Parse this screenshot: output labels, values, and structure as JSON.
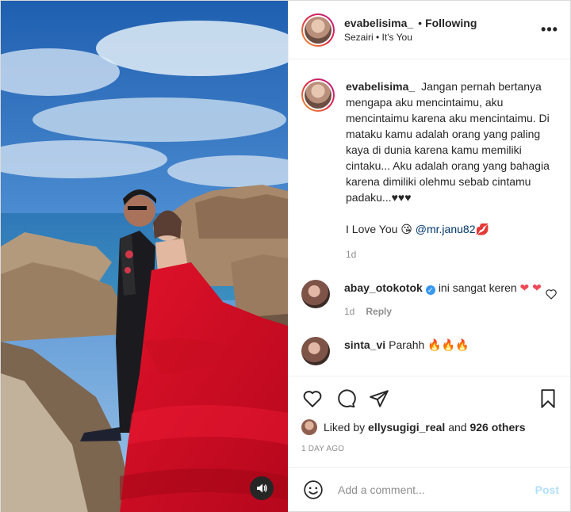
{
  "post": {
    "username": "evabelisima_",
    "follow_status": "Following",
    "separator": "•",
    "music": "Sezairi • It's You",
    "more": "•••"
  },
  "caption": {
    "username": "evabelisima_",
    "text": "Jangan pernah bertanya mengapa aku mencintaimu, aku mencintaimu karena aku mencintaimu. Di mataku kamu adalah orang yang paling kaya di dunia karena kamu memiliki cintaku... Aku adalah orang yang bahagia karena dimiliki olehmu sebab cintamu padaku...♥♥♥",
    "line2_prefix": "I Love You 😘 ",
    "mention": "@mr.janu82",
    "line2_suffix": "💋",
    "age": "1d"
  },
  "comments": [
    {
      "username": "abay_otokotok",
      "verified": "✓",
      "text": "ini sangat keren",
      "hearts": "❤ ❤",
      "age": "1d",
      "reply": "Reply"
    },
    {
      "username": "sinta_vi",
      "text": "Parahh 🔥🔥🔥"
    }
  ],
  "likes": {
    "prefix": "Liked by ",
    "user": "ellysugigi_real",
    "middle": " and ",
    "others": "926 others"
  },
  "timestamp": "1 DAY AGO",
  "composer": {
    "placeholder": "Add a comment...",
    "post_label": "Post"
  },
  "colors": {
    "link": "#00376b",
    "verified": "#3897f0",
    "post_disabled": "#b2dffc",
    "muted": "#8e8e8e",
    "heart": "#ed4956"
  },
  "icons": [
    "audio-icon",
    "more-icon",
    "heart-icon",
    "comment-icon",
    "share-icon",
    "bookmark-icon",
    "emoji-icon"
  ]
}
